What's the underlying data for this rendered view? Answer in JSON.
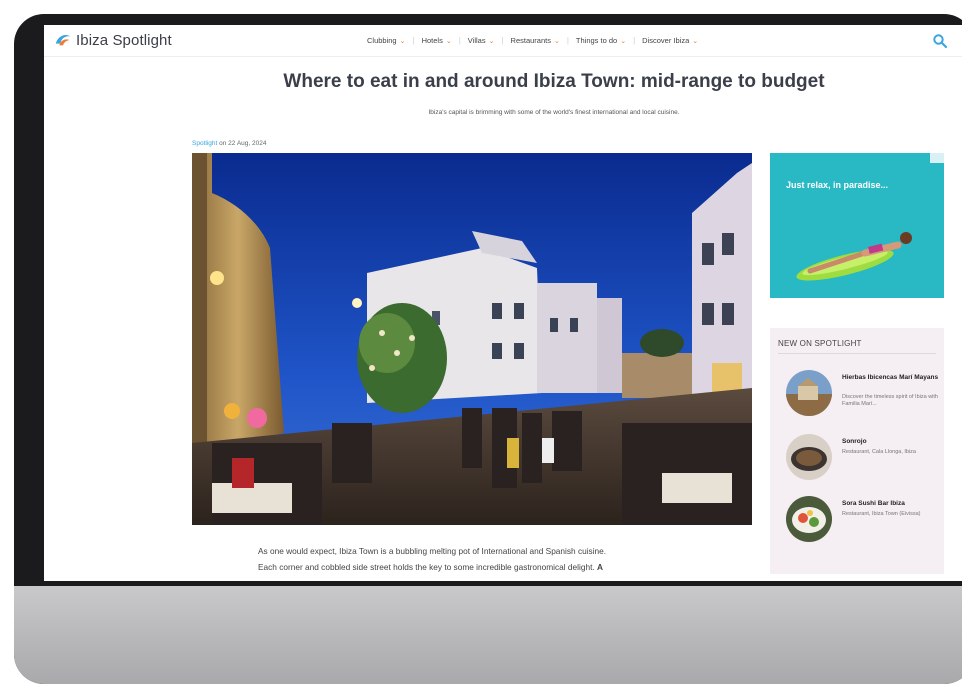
{
  "nav": {
    "logo": "Ibiza Spotlight",
    "menu": [
      {
        "label": "Clubbing"
      },
      {
        "label": "Hotels"
      },
      {
        "label": "Villas"
      },
      {
        "label": "Restaurants"
      },
      {
        "label": "Things to do"
      },
      {
        "label": "Discover Ibiza"
      }
    ],
    "caret": "⌄"
  },
  "article": {
    "title": "Where to eat in and around Ibiza Town: mid-range to budget",
    "subtitle": "Ibiza's capital is brimming with some of the world's finest international and local cuisine.",
    "author": "Spotlight",
    "date_prefix": " on 22 Aug, 2024",
    "body_line1": "As one would expect, Ibiza Town is a bubbling melting pot of International and Spanish cuisine.",
    "body_line2": "Each corner and cobbled side street holds the key to some incredible gastronomical delight. ",
    "body_line2_bold": "A"
  },
  "ad": {
    "text": "Just relax, in paradise..."
  },
  "sidebar": {
    "title": "NEW ON SPOTLIGHT",
    "items": [
      {
        "title": "Hierbas Ibicencas Marí Mayans",
        "desc": "Discover the timeless spirit of Ibiza with Familia Marí..."
      },
      {
        "title": "Sonrojo",
        "desc": "Restaurant, Cala Llonga, Ibiza"
      },
      {
        "title": "Sora Sushi Bar Ibiza",
        "desc": "Restaurant, Ibiza Town (Eivissa)"
      }
    ]
  },
  "colors": {
    "accent": "#f07c34",
    "link": "#3aa6dd",
    "ad_bg": "#28b9c4",
    "sidebar_bg": "#f5eef2"
  }
}
